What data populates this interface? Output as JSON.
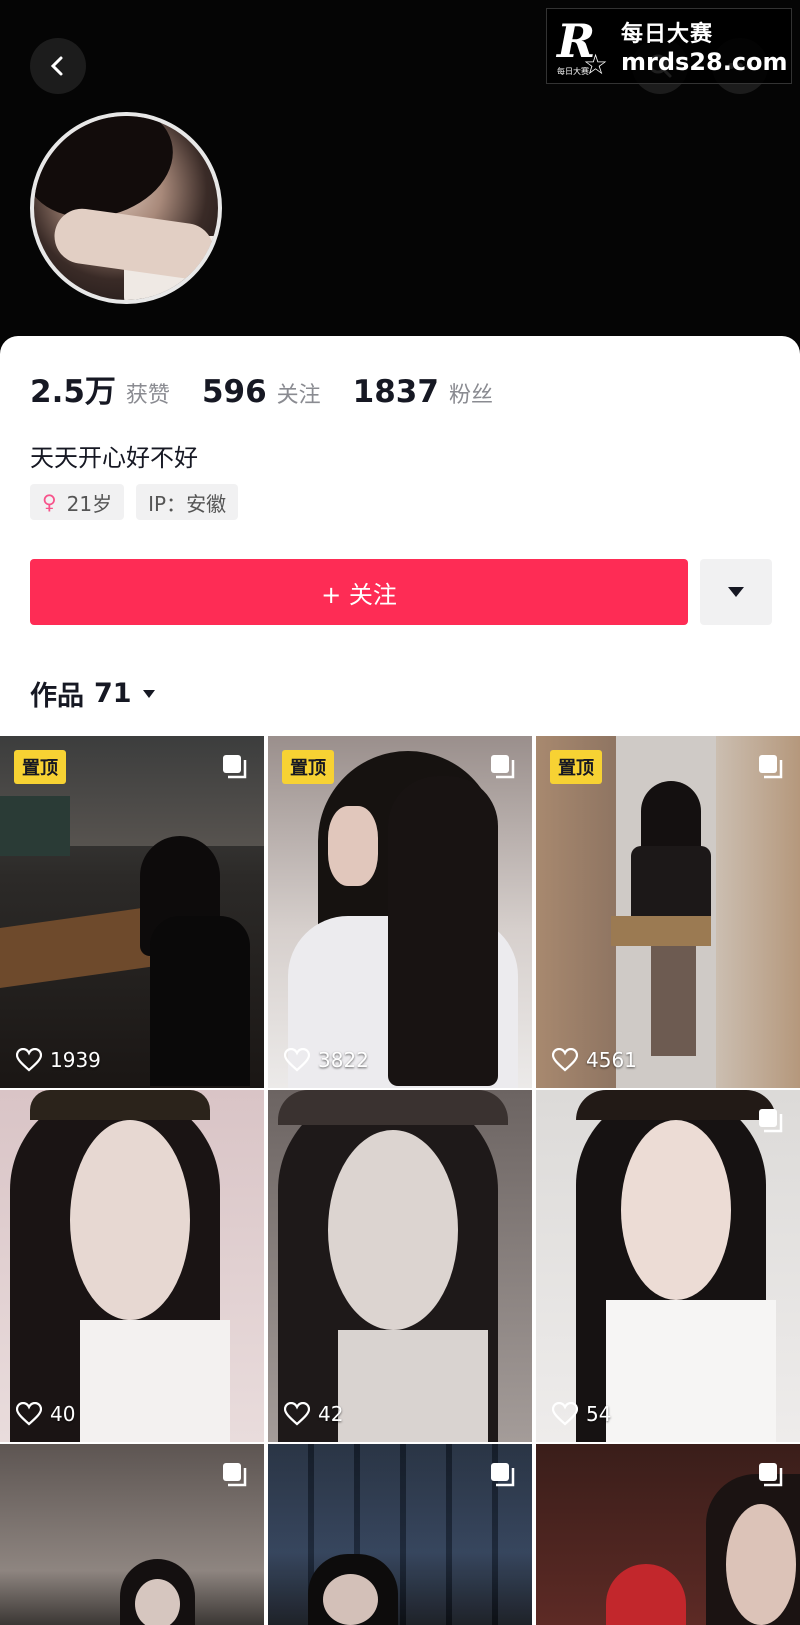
{
  "watermark": {
    "brand": "每日大赛",
    "domain": "mrds28.com",
    "small": "每日大赛"
  },
  "stats": [
    {
      "value": "2.5万",
      "label": "获赞"
    },
    {
      "value": "596",
      "label": "关注"
    },
    {
      "value": "1837",
      "label": "粉丝"
    }
  ],
  "bio": "天天开心好不好",
  "tags": {
    "age": "21岁",
    "ip": "IP：安徽"
  },
  "follow_label": "+ 关注",
  "works": {
    "label": "作品",
    "count": "71"
  },
  "posts": [
    {
      "pinned": "置顶",
      "likes": "1939"
    },
    {
      "pinned": "置顶",
      "likes": "3822"
    },
    {
      "pinned": "置顶",
      "likes": "4561"
    },
    {
      "likes": "40"
    },
    {
      "likes": "42"
    },
    {
      "likes": "54"
    },
    {},
    {},
    {}
  ],
  "icons": [
    "back-icon",
    "search-icon",
    "more-icon",
    "gender-female-icon",
    "dropdown-icon",
    "multi-image-icon",
    "heart-icon"
  ]
}
